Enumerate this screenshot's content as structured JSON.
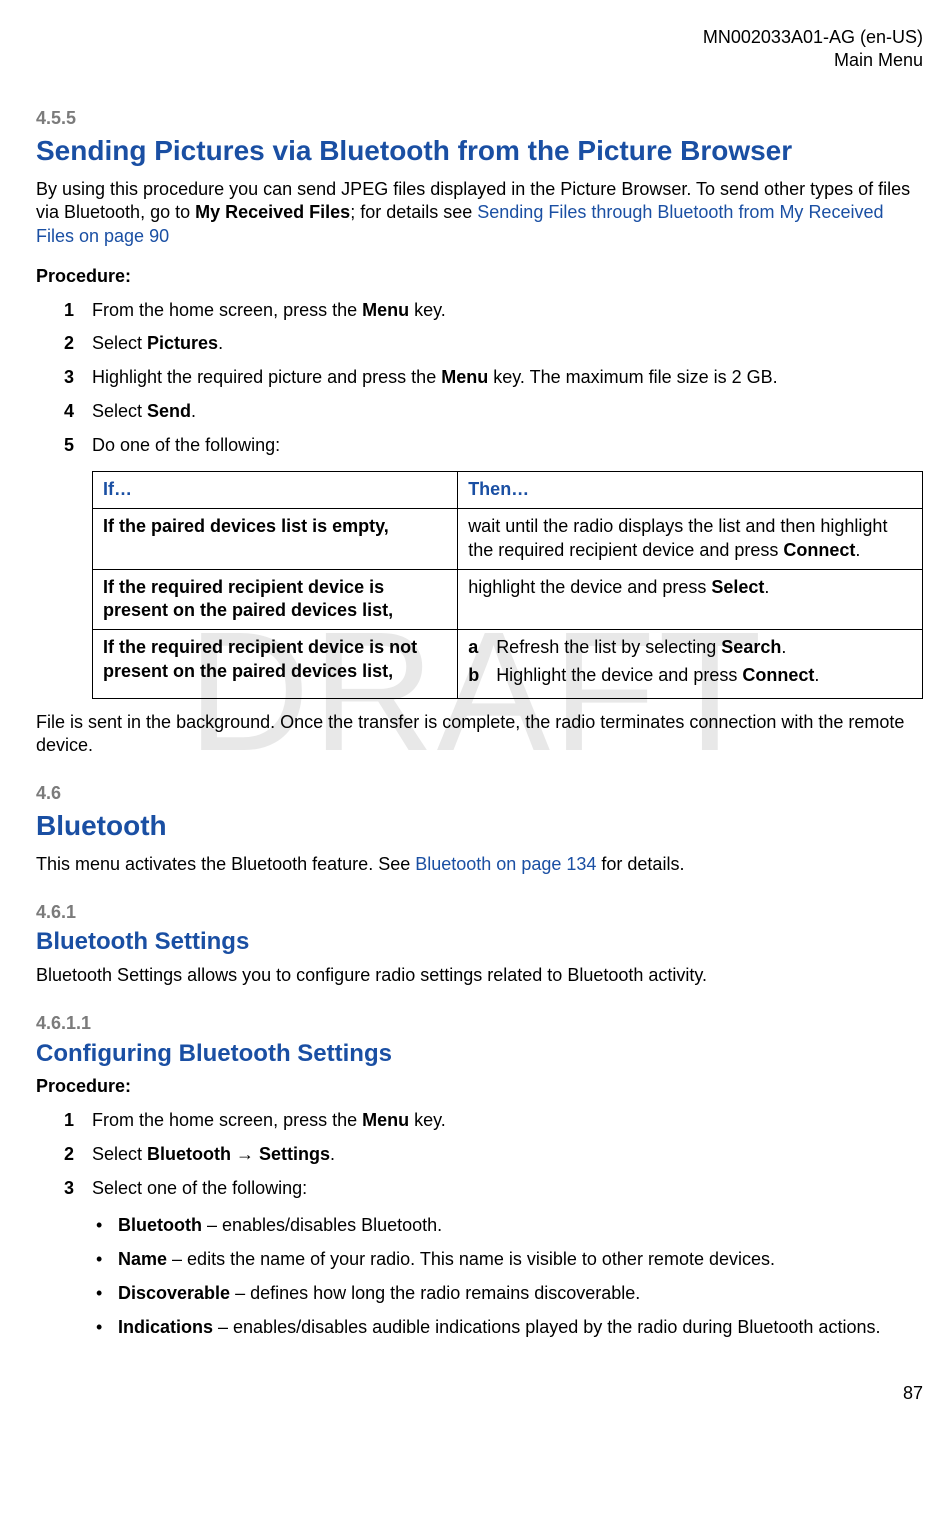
{
  "header": {
    "doc_id": "MN002033A01-AG (en-US)",
    "main_menu": "Main Menu"
  },
  "watermark": "DRAFT",
  "sec_455": {
    "num": "4.5.5",
    "title": "Sending Pictures via Bluetooth from the Picture Browser",
    "intro_a": "By using this procedure you can send JPEG files displayed in the Picture Browser. To send other types of files via Bluetooth, go to ",
    "intro_bold": "My Received Files",
    "intro_b": "; for details see ",
    "intro_link": "Sending Files through Bluetooth from My Received Files on page 90",
    "procedure_label": "Procedure:",
    "step1_a": "From the home screen, press the ",
    "step1_bold": "Menu",
    "step1_b": " key.",
    "step2_a": "Select ",
    "step2_bold": "Pictures",
    "step2_b": ".",
    "step3_a": "Highlight the required picture and press the ",
    "step3_bold": "Menu",
    "step3_b": " key. The maximum file size is 2 GB.",
    "step4_a": "Select ",
    "step4_bold": "Send",
    "step4_b": ".",
    "step5": "Do one of the following:",
    "table": {
      "if_header": "If…",
      "then_header": "Then…",
      "row1_if": "If the paired devices list is empty,",
      "row1_then_a": "wait until the radio displays the list and then highlight the required recipient device and press ",
      "row1_then_bold": "Connect",
      "row1_then_b": ".",
      "row2_if": "If the required recipient device is present on the paired devices list,",
      "row2_then_a": "highlight the device and press ",
      "row2_then_bold": "Select",
      "row2_then_b": ".",
      "row3_if": "If the required recipient device is not present on the paired devices list,",
      "row3_a_letter": "a",
      "row3_a_text_a": "Refresh the list by selecting ",
      "row3_a_bold": "Search",
      "row3_a_text_b": ".",
      "row3_b_letter": "b",
      "row3_b_text_a": "Highlight the device and press ",
      "row3_b_bold": "Connect",
      "row3_b_text_b": "."
    },
    "post_table": "File is sent in the background. Once the transfer is complete, the radio terminates connection with the remote device."
  },
  "sec_46": {
    "num": "4.6",
    "title": "Bluetooth",
    "text_a": "This menu activates the Bluetooth feature. See ",
    "text_link": "Bluetooth on page 134",
    "text_b": " for details."
  },
  "sec_461": {
    "num": "4.6.1",
    "title": "Bluetooth Settings",
    "text": "Bluetooth Settings allows you to configure radio settings related to Bluetooth activity."
  },
  "sec_4611": {
    "num": "4.6.1.1",
    "title": "Configuring Bluetooth Settings",
    "procedure_label": "Procedure:",
    "step1_a": "From the home screen, press the ",
    "step1_bold": "Menu",
    "step1_b": " key.",
    "step2_a": "Select ",
    "step2_bold1": "Bluetooth",
    "step2_arrow": " → ",
    "step2_bold2": "Settings",
    "step2_b": ".",
    "step3": "Select one of the following:",
    "bullet1_bold": "Bluetooth",
    "bullet1_rest": " – enables/disables Bluetooth.",
    "bullet2_bold": "Name",
    "bullet2_rest": " – edits the name of your radio. This name is visible to other remote devices.",
    "bullet3_bold": "Discoverable",
    "bullet3_rest": " – defines how long the radio remains discoverable.",
    "bullet4_bold": "Indications",
    "bullet4_rest": " – enables/disables audible indications played by the radio during Bluetooth actions."
  },
  "page_number": "87"
}
